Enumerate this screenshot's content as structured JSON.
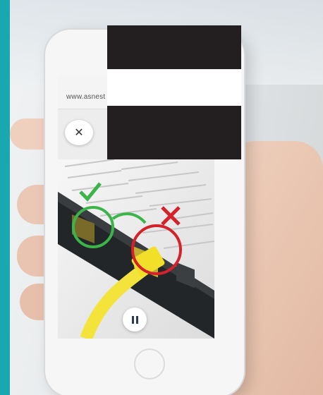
{
  "colors": {
    "accent_bar": "#19a7b0",
    "check_mark": "#3bb54a",
    "cross_mark": "#d4222a",
    "cable": "#f4e33a"
  },
  "browser": {
    "url": "www.asnest"
  },
  "overlay": {
    "close_icon": "close-icon",
    "close_glyph": "✕",
    "pause_icon": "pause-icon"
  }
}
